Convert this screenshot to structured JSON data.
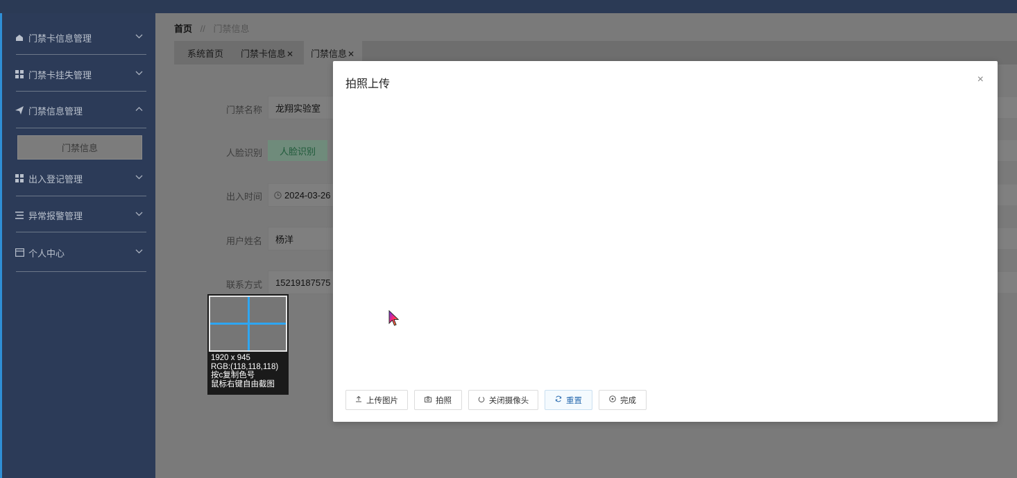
{
  "sidebar": {
    "items": [
      {
        "label": "门禁卡信息管理",
        "icon": "home-icon"
      },
      {
        "label": "门禁卡挂失管理",
        "icon": "grid-icon"
      },
      {
        "label": "门禁信息管理",
        "icon": "send-icon"
      },
      {
        "label": "出入登记管理",
        "icon": "grid-icon"
      },
      {
        "label": "异常报警管理",
        "icon": "list-icon"
      },
      {
        "label": "个人中心",
        "icon": "card-icon"
      }
    ],
    "sub_item": "门禁信息"
  },
  "breadcrumb": {
    "home": "首页",
    "separator": "//",
    "current": "门禁信息"
  },
  "tabs": [
    {
      "label": "系统首页",
      "closable": false
    },
    {
      "label": "门禁卡信息",
      "closable": true
    },
    {
      "label": "门禁信息",
      "closable": true
    }
  ],
  "form": {
    "name_label": "门禁名称",
    "name_value": "龙翔实验室",
    "face_label": "人脸识别",
    "face_button": "人脸识别",
    "time_label": "出入时间",
    "time_value": "2024-03-26",
    "user_label": "用户姓名",
    "user_value": "杨洋",
    "contact_label": "联系方式",
    "contact_value": "15219187575"
  },
  "magnifier": {
    "line1": "1920 x 945",
    "line2": "RGB:(118,118,118)",
    "line3": "按c复制色号",
    "line4": "鼠标右键自由截图"
  },
  "modal": {
    "title": "拍照上传",
    "close": "×",
    "buttons": {
      "upload": "上传图片",
      "capture": "拍照",
      "close_camera": "关闭摄像头",
      "reset": "重置",
      "done": "完成"
    }
  },
  "colors": {
    "sidebar_bg": "#2c3b58",
    "accent": "#2f8fd6",
    "magnifier_cross": "#2ea6f2"
  }
}
